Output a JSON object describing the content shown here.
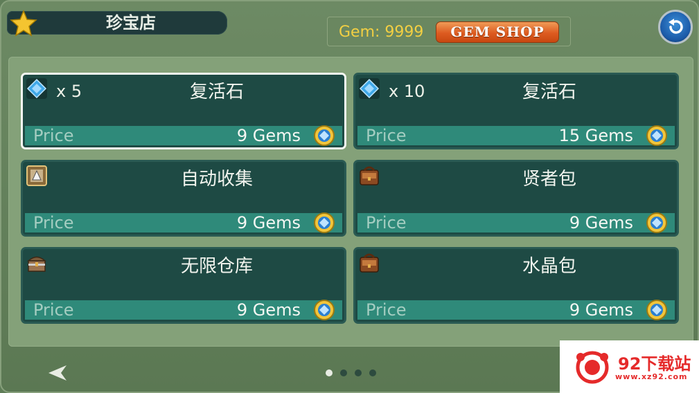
{
  "header": {
    "title": "珍宝店",
    "gem_balance": "Gem: 9999",
    "gem_shop_label": "GEM SHOP"
  },
  "shop": {
    "price_label": "Price",
    "items": [
      {
        "icon": "blue-gem-icon",
        "qty": "x 5",
        "name": "复活石",
        "price": "9 Gems",
        "selected": true
      },
      {
        "icon": "blue-gem-icon",
        "qty": "x 10",
        "name": "复活石",
        "price": "15 Gems",
        "selected": false
      },
      {
        "icon": "auto-collect-icon",
        "qty": "",
        "name": "自动收集",
        "price": "9 Gems",
        "selected": false
      },
      {
        "icon": "satchel-icon",
        "qty": "",
        "name": "贤者包",
        "price": "9 Gems",
        "selected": false
      },
      {
        "icon": "chest-icon",
        "qty": "",
        "name": "无限仓库",
        "price": "9 Gems",
        "selected": false
      },
      {
        "icon": "satchel-icon",
        "qty": "",
        "name": "水晶包",
        "price": "9 Gems",
        "selected": false
      }
    ]
  },
  "pagination": {
    "pages": 4,
    "current": 1
  },
  "watermark": {
    "title": "92下载站",
    "url": "www.xz92.com"
  },
  "colors": {
    "card": "#1e4a44",
    "price_bar": "#2f8a7a",
    "gem_text": "#f2cf43",
    "shop_button": "#dd5b20"
  }
}
